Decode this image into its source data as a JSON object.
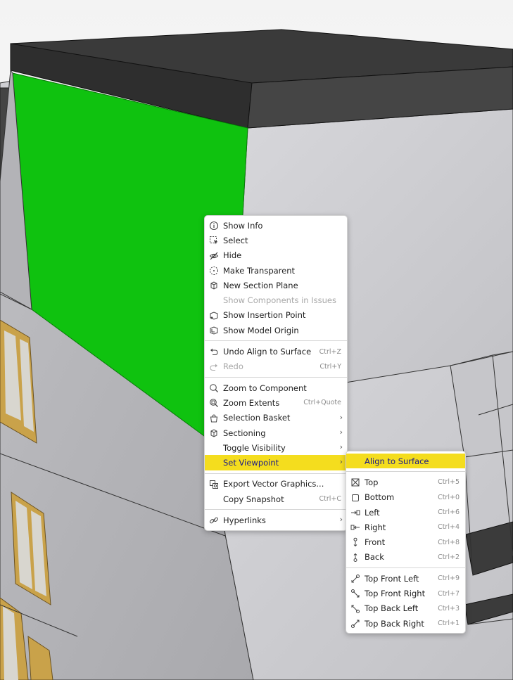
{
  "context_menu": {
    "items": [
      {
        "type": "item",
        "label": "Show Info",
        "icon": "info-icon"
      },
      {
        "type": "item",
        "label": "Select",
        "icon": "select-icon"
      },
      {
        "type": "item",
        "label": "Hide",
        "icon": "hide-icon"
      },
      {
        "type": "item",
        "label": "Make Transparent",
        "icon": "transparent-icon"
      },
      {
        "type": "item",
        "label": "New Section Plane",
        "icon": "section-plane-icon"
      },
      {
        "type": "item",
        "label": "Show Components in Issues",
        "disabled": true
      },
      {
        "type": "item",
        "label": "Show Insertion Point",
        "icon": "insertion-point-icon"
      },
      {
        "type": "item",
        "label": "Show Model Origin",
        "icon": "model-origin-icon"
      },
      {
        "type": "separator"
      },
      {
        "type": "item",
        "label": "Undo Align to Surface",
        "icon": "undo-icon",
        "shortcut": "Ctrl+Z"
      },
      {
        "type": "item",
        "label": "Redo",
        "icon": "redo-icon",
        "shortcut": "Ctrl+Y",
        "disabled": true
      },
      {
        "type": "separator"
      },
      {
        "type": "item",
        "label": "Zoom to Component",
        "icon": "zoom-component-icon"
      },
      {
        "type": "item",
        "label": "Zoom Extents",
        "icon": "zoom-extents-icon",
        "shortcut": "Ctrl+Quote"
      },
      {
        "type": "item",
        "label": "Selection Basket",
        "icon": "basket-icon",
        "submenu": true
      },
      {
        "type": "item",
        "label": "Sectioning",
        "icon": "sectioning-icon",
        "submenu": true
      },
      {
        "type": "item",
        "label": "Toggle Visibility",
        "submenu": true
      },
      {
        "type": "item",
        "label": "Set Viewpoint",
        "submenu": true,
        "highlight": true
      },
      {
        "type": "separator"
      },
      {
        "type": "item",
        "label": "Export Vector Graphics...",
        "icon": "export-icon"
      },
      {
        "type": "item",
        "label": "Copy Snapshot",
        "shortcut": "Ctrl+C"
      },
      {
        "type": "separator"
      },
      {
        "type": "item",
        "label": "Hyperlinks",
        "icon": "link-icon",
        "submenu": true
      }
    ],
    "submenu_arrow": "›"
  },
  "viewpoint_submenu": {
    "items": [
      {
        "type": "item",
        "label": "Align to Surface",
        "highlight": true
      },
      {
        "type": "separator"
      },
      {
        "type": "item",
        "label": "Top",
        "icon": "top-view-icon",
        "shortcut": "Ctrl+5"
      },
      {
        "type": "item",
        "label": "Bottom",
        "icon": "bottom-view-icon",
        "shortcut": "Ctrl+0"
      },
      {
        "type": "item",
        "label": "Left",
        "icon": "left-view-icon",
        "shortcut": "Ctrl+6"
      },
      {
        "type": "item",
        "label": "Right",
        "icon": "right-view-icon",
        "shortcut": "Ctrl+4"
      },
      {
        "type": "item",
        "label": "Front",
        "icon": "front-view-icon",
        "shortcut": "Ctrl+8"
      },
      {
        "type": "item",
        "label": "Back",
        "icon": "back-view-icon",
        "shortcut": "Ctrl+2"
      },
      {
        "type": "separator"
      },
      {
        "type": "item",
        "label": "Top Front Left",
        "icon": "top-front-left-icon",
        "shortcut": "Ctrl+9"
      },
      {
        "type": "item",
        "label": "Top Front Right",
        "icon": "top-front-right-icon",
        "shortcut": "Ctrl+7"
      },
      {
        "type": "item",
        "label": "Top Back Left",
        "icon": "top-back-left-icon",
        "shortcut": "Ctrl+3"
      },
      {
        "type": "item",
        "label": "Top Back Right",
        "icon": "top-back-right-icon",
        "shortcut": "Ctrl+1"
      }
    ]
  },
  "colors": {
    "highlight": "#f4dd1e",
    "selected_surface": "#0fc20f",
    "roof": "#3a3a3a",
    "wall_light": "#cfcfd3",
    "wall_mid": "#b8b8bc",
    "window_frame": "#c9a24a"
  }
}
